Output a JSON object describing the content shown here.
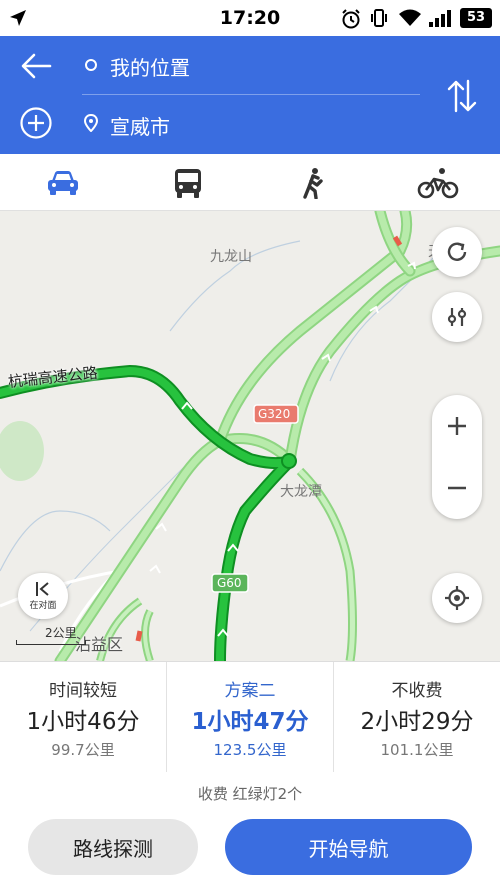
{
  "status_bar": {
    "time": "17:20",
    "battery": "53"
  },
  "header": {
    "origin": "我的位置",
    "destination": "宣威市"
  },
  "modes": [
    {
      "name": "car-mode",
      "icon": "car-icon",
      "active": true
    },
    {
      "name": "bus-mode",
      "icon": "bus-icon",
      "active": false
    },
    {
      "name": "walk-mode",
      "icon": "walk-icon",
      "active": false
    },
    {
      "name": "bike-mode",
      "icon": "bike-icon",
      "active": false
    }
  ],
  "map": {
    "labels": {
      "mountain": "九龙山",
      "expressway": "杭瑞高速公路",
      "road_g320": "G320",
      "place_dalongtan": "大龙潭",
      "road_g60": "G60",
      "district": "沾益区",
      "edge_char": "天"
    },
    "scale": "2公里",
    "compass_label": "在对面"
  },
  "routes": [
    {
      "name": "时间较短",
      "duration": "1小时46分",
      "distance": "99.7公里",
      "selected": false
    },
    {
      "name": "方案二",
      "duration": "1小时47分",
      "distance": "123.5公里",
      "selected": true
    },
    {
      "name": "不收费",
      "duration": "2小时29分",
      "distance": "101.1公里",
      "selected": false
    }
  ],
  "route_info": "收费  红绿灯2个",
  "buttons": {
    "probe": "路线探测",
    "start": "开始导航"
  },
  "colors": {
    "header_blue": "#3a6de0",
    "route_green": "#22b33a",
    "alt_route_green": "#a9e39a"
  }
}
